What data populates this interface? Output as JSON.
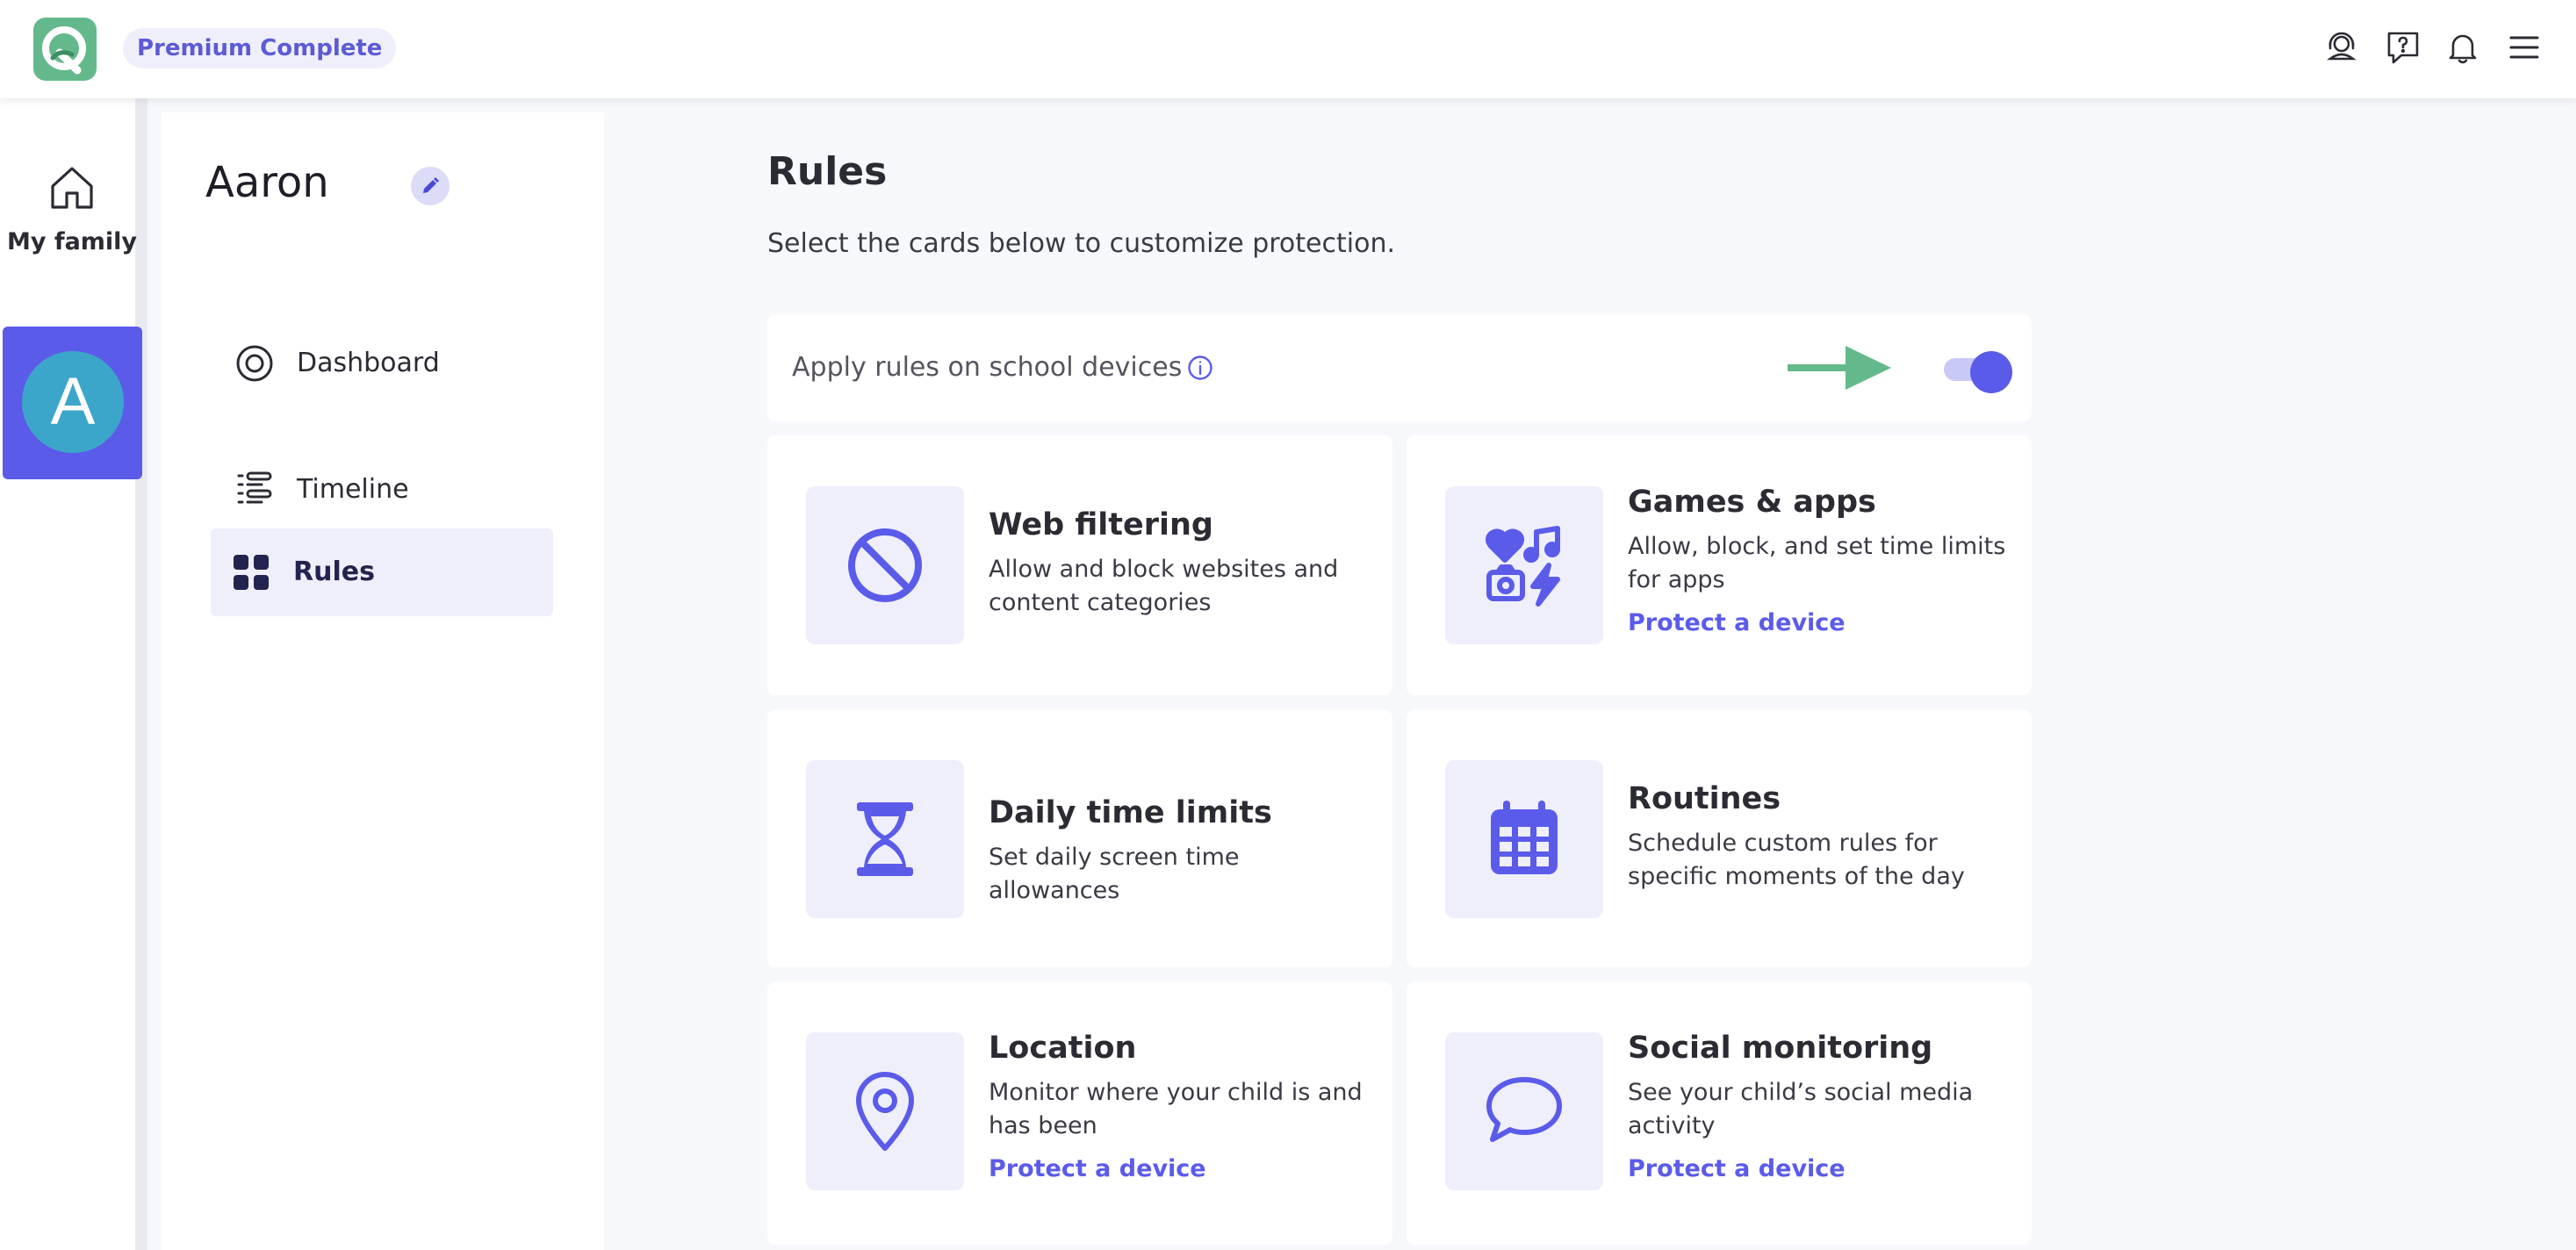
{
  "header": {
    "plan_badge": "Premium Complete",
    "icons": [
      "support-agent-icon",
      "help-icon",
      "bell-icon",
      "menu-icon"
    ]
  },
  "rail": {
    "home_label": "My family",
    "member_initial": "A"
  },
  "profile": {
    "name": "Aaron",
    "nav": [
      {
        "label": "Dashboard",
        "icon": "dashboard-icon",
        "active": false
      },
      {
        "label": "Timeline",
        "icon": "timeline-icon",
        "active": false
      },
      {
        "label": "Rules",
        "icon": "grid-icon",
        "active": true
      }
    ]
  },
  "main": {
    "title": "Rules",
    "subtitle": "Select the cards below to customize protection.",
    "school_devices": {
      "label": "Apply rules on school devices",
      "enabled": true
    },
    "cards": [
      {
        "title": "Web filtering",
        "description": "Allow and block websites and content categories",
        "link": "",
        "icon": "block-icon"
      },
      {
        "title": "Games & apps",
        "description": "Allow, block, and set time limits for apps",
        "link": "Protect a device",
        "icon": "apps-icon"
      },
      {
        "title": "Daily time limits",
        "description": "Set daily screen time allowances",
        "link": "",
        "icon": "hourglass-icon"
      },
      {
        "title": "Routines",
        "description": "Schedule custom rules for specific moments of the day",
        "link": "",
        "icon": "calendar-icon"
      },
      {
        "title": "Location",
        "description": "Monitor where your child is and has been",
        "link": "Protect a device",
        "icon": "location-pin-icon"
      },
      {
        "title": "Social monitoring",
        "description": "See your child’s social media activity",
        "link": "Protect a device",
        "icon": "chat-bubble-icon"
      }
    ]
  },
  "colors": {
    "accent": "#5b5bea",
    "brand_green": "#64b98c",
    "avatar": "#3ba6c9"
  }
}
